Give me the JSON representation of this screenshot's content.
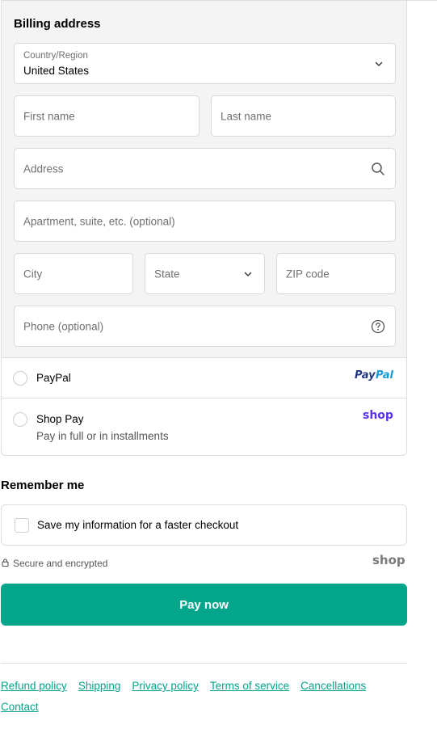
{
  "billing": {
    "title": "Billing address",
    "country": {
      "label": "Country/Region",
      "value": "United States"
    },
    "first_name": {
      "placeholder": "First name"
    },
    "last_name": {
      "placeholder": "Last name"
    },
    "address": {
      "placeholder": "Address"
    },
    "apartment": {
      "placeholder": "Apartment, suite, etc. (optional)"
    },
    "city": {
      "placeholder": "City"
    },
    "state": {
      "placeholder": "State"
    },
    "zip": {
      "placeholder": "ZIP code"
    },
    "phone": {
      "placeholder": "Phone (optional)"
    }
  },
  "payment_options": [
    {
      "label": "PayPal",
      "logo": "PayPal",
      "logo_colors": [
        "#253b80",
        "#179bd7"
      ],
      "icon": "paypal-logo"
    },
    {
      "label": "Shop Pay",
      "sublabel": "Pay in full or in installments",
      "logo": "shop",
      "logo_color": "#5a31f4",
      "icon": "shop-pay-logo"
    }
  ],
  "remember": {
    "title": "Remember me",
    "checkbox_label": "Save my information for a faster checkout",
    "checked": false
  },
  "secure": {
    "text": "Secure and encrypted",
    "icon": "lock-icon",
    "shop_logo": "shop",
    "shop_logo_color": "#7a7a7a"
  },
  "pay_button": {
    "label": "Pay now",
    "color": "#03a58b"
  },
  "footer": {
    "links": [
      "Refund policy",
      "Shipping",
      "Privacy policy",
      "Terms of service",
      "Cancellations",
      "Contact"
    ],
    "link_color": "#03a58b"
  }
}
